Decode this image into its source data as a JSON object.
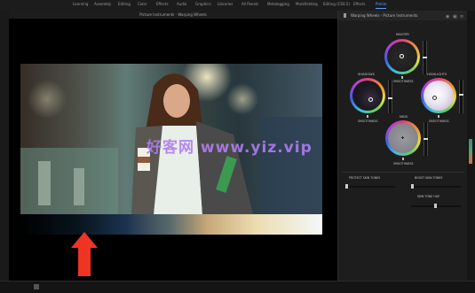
{
  "workspaces": [
    "Learning",
    "Assembly",
    "Editing",
    "Color",
    "Effects",
    "Audio",
    "Graphics",
    "Libraries",
    "All Panels",
    "Metalogging",
    "Markfielding",
    "Editing (CS6.5)",
    "Effects",
    "Prelim"
  ],
  "active_workspace_index": 13,
  "monitor": {
    "title": "Picture Instruments - Warping Wheels"
  },
  "watermark": "好客网 www.yiz.vip",
  "panel": {
    "title": "Warping Wheels - Picture Instruments",
    "wheels": {
      "master": {
        "label": "MASTER",
        "slider_label": "SMOOTHNESS"
      },
      "shadows": {
        "label": "SHADOWS",
        "slider_label": "SMOOTHNESS"
      },
      "highlights": {
        "label": "HIGHLIGHTS",
        "slider_label": "SMOOTHNESS"
      },
      "mids": {
        "label": "MIDS",
        "slider_label": "SMOOTHNESS"
      }
    },
    "controls": {
      "protect_skin": "PROTECT SKIN TONES",
      "boost_skin": "BOOST SKIN TONES",
      "skin_tone_hue": "SKIN TONE HUE"
    }
  },
  "colors": {
    "arrow": "#f03424",
    "accent": "#5aa0ff"
  }
}
